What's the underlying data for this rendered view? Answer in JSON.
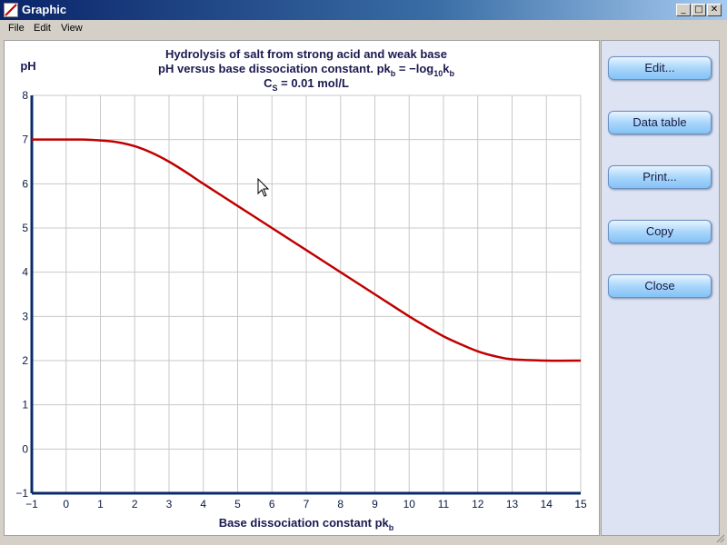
{
  "window": {
    "title": "Graphic",
    "controls": {
      "minimize": "_",
      "maximize": "□",
      "close": "✕"
    }
  },
  "menu": {
    "items": [
      "File",
      "Edit",
      "View"
    ]
  },
  "buttons": {
    "edit": "Edit...",
    "data_table": "Data table",
    "print": "Print...",
    "copy": "Copy",
    "close": "Close"
  },
  "chart_data": {
    "type": "line",
    "title": "Hydrolysis of salt from strong acid and weak base",
    "subtitle_line2": {
      "text_a": "pH versus base dissociation constant.  pk",
      "sub_a": "b",
      "text_b": " = −log",
      "sub_b": "10",
      "text_c": "k",
      "sub_c": "b"
    },
    "subtitle_line3": {
      "text_a": "C",
      "sub_a": "S",
      "text_b": " = 0.01 mol/L"
    },
    "ylabel": "pH",
    "xlabel": {
      "text": "Base dissociation constant pk",
      "sub": "b"
    },
    "xlim": [
      -1,
      15
    ],
    "ylim": [
      -1,
      8
    ],
    "x_ticks": [
      "−1",
      "0",
      "1",
      "2",
      "3",
      "4",
      "5",
      "6",
      "7",
      "8",
      "9",
      "10",
      "11",
      "12",
      "13",
      "14",
      "15"
    ],
    "y_ticks": [
      "−1",
      "0",
      "1",
      "2",
      "3",
      "4",
      "5",
      "6",
      "7",
      "8"
    ],
    "grid": true,
    "line_color": "#c00000",
    "axis_color": "#0a2a6a",
    "series": [
      {
        "x": [
          -1,
          0,
          0.5,
          1,
          1.5,
          2,
          2.5,
          3,
          3.5,
          4,
          5,
          6,
          7,
          8,
          9,
          10,
          10.5,
          11,
          11.5,
          12,
          12.5,
          13,
          14,
          15
        ],
        "values": [
          7.0,
          7.0,
          7.0,
          6.98,
          6.94,
          6.85,
          6.7,
          6.5,
          6.26,
          6.0,
          5.5,
          5.0,
          4.5,
          4.0,
          3.5,
          3.0,
          2.77,
          2.55,
          2.37,
          2.21,
          2.1,
          2.03,
          2.0,
          2.0
        ]
      }
    ]
  }
}
